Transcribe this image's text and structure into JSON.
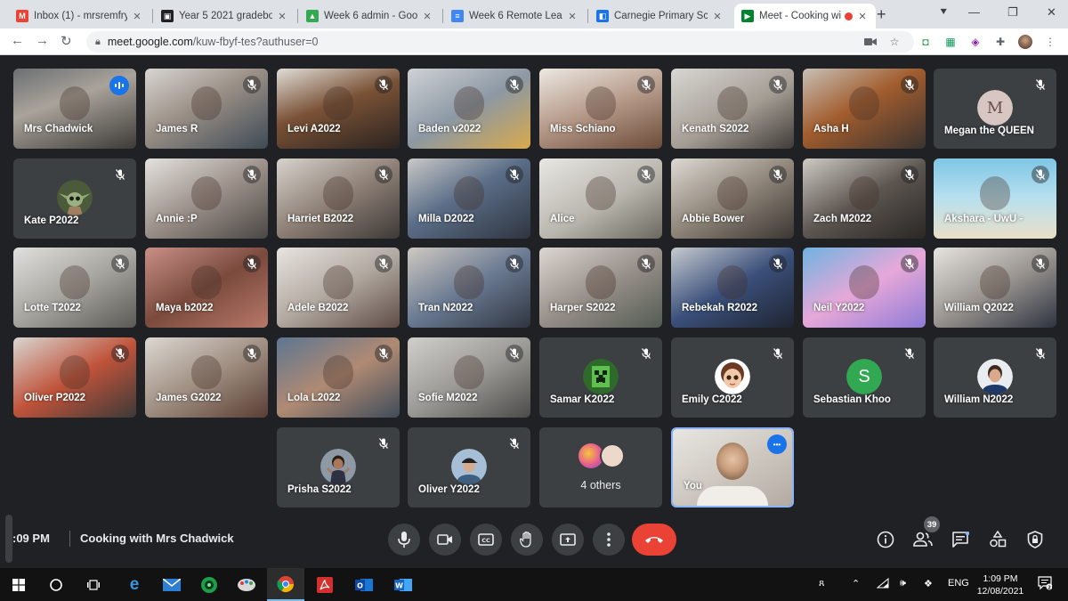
{
  "tabs": [
    {
      "label": "Inbox (1) - mrsremfry@",
      "icon": "gmail-icon",
      "color": "#ea4335",
      "glyph": "M"
    },
    {
      "label": "Year 5 2021 gradebook",
      "icon": "classroom-icon",
      "color": "#202124",
      "glyph": "▣"
    },
    {
      "label": "Week 6 admin - Google",
      "icon": "drive-icon",
      "color": "#34a853",
      "glyph": "▲"
    },
    {
      "label": "Week 6 Remote Learning",
      "icon": "docs-icon",
      "color": "#4285f4",
      "glyph": "≡"
    },
    {
      "label": "Carnegie Primary Scho",
      "icon": "sites-icon",
      "color": "#1a73e8",
      "glyph": "◧"
    },
    {
      "label": "Meet - Cooking wi",
      "icon": "meet-icon",
      "color": "#00832d",
      "glyph": "▶",
      "active": true
    }
  ],
  "address": {
    "host": "meet.google.com",
    "path": "/kuw-fbyf-tes?authuser=0"
  },
  "participants": [
    {
      "name": "Mrs Chadwick",
      "speaking": true,
      "bg": "linear-gradient(160deg,#6b6f73 0%,#a9a39a 40%,#3d3a37 100%)"
    },
    {
      "name": "James R",
      "bg": "linear-gradient(150deg,#d8d6d2 0%,#9a8f86 45%,#3e4a55 100%)"
    },
    {
      "name": "Levi A2022",
      "bg": "linear-gradient(160deg,#e0ddd8 0%,#7a5236 45%,#2b2320 100%)"
    },
    {
      "name": "Baden v2022",
      "bg": "linear-gradient(150deg,#cfd2d5 0%,#8c98a4 50%,#d9a94a 100%)"
    },
    {
      "name": "Miss Schiano",
      "bg": "linear-gradient(160deg,#ece8e2 0%,#b59988 50%,#6b4b3a 100%)"
    },
    {
      "name": "Kenath S2022",
      "bg": "linear-gradient(150deg,#d9d7d3 0%,#a49d94 55%,#3f3b37 100%)"
    },
    {
      "name": "Asha H",
      "bg": "linear-gradient(150deg,#c8c0b7 0%,#a25d2e 45%,#3a3330 100%)"
    },
    {
      "name": "Megan the QUEEN",
      "avatar": "M",
      "avatarBg": "#d7c6c2"
    },
    {
      "name": "Kate P2022",
      "avatar": "baby-yoda",
      "avatarBg": "#7b8b5c"
    },
    {
      "name": "Annie :P",
      "bg": "linear-gradient(150deg,#e4e2de 0%,#9b9089 50%,#4a4744 100%)"
    },
    {
      "name": "Harriet B2022",
      "bg": "linear-gradient(150deg,#d7d3cd 0%,#8e8076 50%,#3d3936 100%)"
    },
    {
      "name": "Milla D2022",
      "bg": "linear-gradient(150deg,#c9c8c6 0%,#5b6e88 45%,#2f3540 100%)"
    },
    {
      "name": "Alice",
      "bg": "linear-gradient(150deg,#e8e7e3 0%,#b9b6ae 55%,#6b6860 100%)"
    },
    {
      "name": "Abbie Bower",
      "bg": "linear-gradient(150deg,#ddd9d3 0%,#8f8579 50%,#3b3632 100%)"
    },
    {
      "name": "Zach M2022",
      "bg": "linear-gradient(150deg,#cfcac4 0%,#5c5550 50%,#2a2725 100%)"
    },
    {
      "name": "Akshara - UwU -",
      "bg": "linear-gradient(180deg,#7fc6e6 0%,#b8e0ee 50%,#e9dfc7 100%)"
    },
    {
      "name": "Lotte T2022",
      "bg": "linear-gradient(150deg,#e0e0de 0%,#a7a59f 50%,#5b5955 100%)"
    },
    {
      "name": "Maya b2022",
      "bg": "linear-gradient(150deg,#c98f86 0%,#7a4a3d 50%,#b77869 100%)"
    },
    {
      "name": "Adele B2022",
      "bg": "linear-gradient(150deg,#e8e4df 0%,#b2a9a1 50%,#5e4c45 100%)"
    },
    {
      "name": "Tran N2022",
      "bg": "linear-gradient(150deg,#cfc9c2 0%,#6a7a92 50%,#2f3540 100%)"
    },
    {
      "name": "Harper S2022",
      "bg": "linear-gradient(150deg,#dcd7d0 0%,#98908a 50%,#525b52 100%)"
    },
    {
      "name": "Rebekah R2022",
      "bg": "linear-gradient(150deg,#c7cbd0 0%,#3a4f7a 50%,#1f2430 100%)"
    },
    {
      "name": "Neil Y2022",
      "bg": "linear-gradient(150deg,#6fb3e0 0%,#e7a8d9 50%,#8d7ad6 100%)"
    },
    {
      "name": "William Q2022",
      "bg": "linear-gradient(150deg,#e6e4e0 0%,#9a9590 50%,#2d3340 100%)"
    },
    {
      "name": "Oliver P2022",
      "bg": "linear-gradient(150deg,#d9d6d2 0%,#c0533a 50%,#3b3a38 100%)"
    },
    {
      "name": "James G2022",
      "bg": "linear-gradient(150deg,#dcd8d2 0%,#a08f82 50%,#5a3d33 100%)"
    },
    {
      "name": "Lola L2022",
      "bg": "linear-gradient(150deg,#5d7691 0%,#b08a73 50%,#3f4c5a 100%)"
    },
    {
      "name": "Sofie M2022",
      "bg": "linear-gradient(150deg,#d0cfcb 0%,#9c9a96 50%,#4b4a48 100%)"
    },
    {
      "name": "Samar K2022",
      "avatar": "creeper",
      "avatarBg": "#4a8f3c"
    },
    {
      "name": "Emily C2022",
      "avatar": "bitmoji",
      "avatarBg": "#f0d5c8"
    },
    {
      "name": "Sebastian Khoo",
      "avatar": "S",
      "avatarBg": "#33a852"
    },
    {
      "name": "William N2022",
      "avatar": "photo",
      "avatarBg": "#d8dde3"
    },
    {
      "name": "Prisha S2022",
      "avatar": "bitmoji-dark",
      "avatarBg": "#6e7a86"
    },
    {
      "name": "Oliver Y2022",
      "avatar": "photo-cap",
      "avatarBg": "#8ca6bf"
    },
    {
      "name": "4 others",
      "others": true
    },
    {
      "name": "You",
      "self": true,
      "bg": "linear-gradient(150deg,#e8e6e2 0%,#cfc9c2 50%,#b3aba2 100%)"
    }
  ],
  "meeting": {
    "time": ":09 PM",
    "title": "Cooking with Mrs Chadwick",
    "participant_count": "39"
  },
  "taskbar": {
    "lang": "ENG",
    "time": "1:09 PM",
    "date": "12/08/2021"
  },
  "colors": {
    "meet_bg": "#202124",
    "tile_bg": "#3c4043",
    "end_call": "#ea4335",
    "accent": "#1a73e8"
  }
}
